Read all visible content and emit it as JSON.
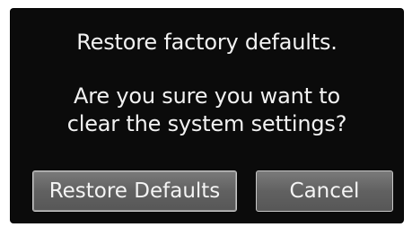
{
  "dialog": {
    "title": "Restore factory defaults.",
    "message_lines": [
      "Are you sure you want to",
      "clear the system settings?"
    ],
    "buttons": {
      "restore_label": "Restore Defaults",
      "cancel_label": "Cancel"
    }
  }
}
